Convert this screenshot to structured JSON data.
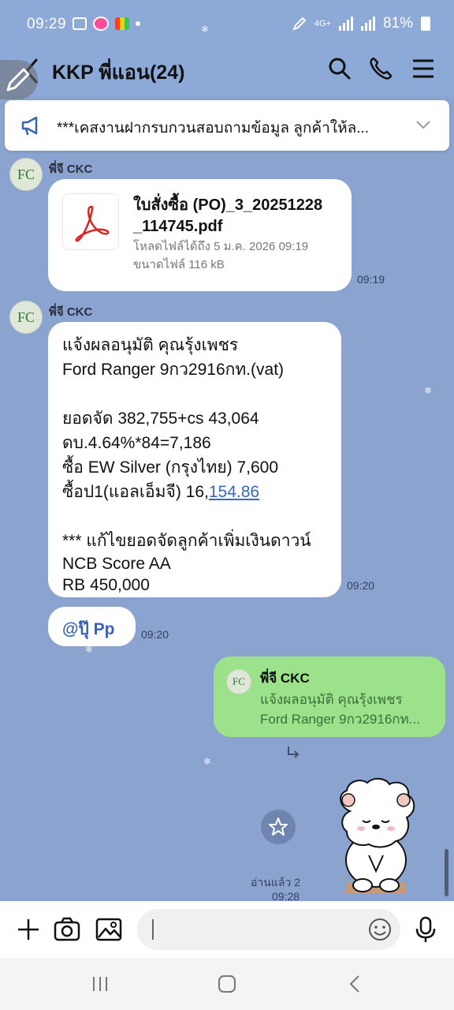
{
  "status_bar": {
    "time": "09:29",
    "network": "4G+",
    "battery": "81%"
  },
  "header": {
    "title": "KKP พี่แอน(24)"
  },
  "announcement": {
    "text": "***เคสงานฝากรบกวนสอบถามข้อมูล ลูกค้าให้ล..."
  },
  "messages": [
    {
      "sender": "พี่จี CKC",
      "avatar_text": "FC",
      "file_name": "ใบสั่งซื้อ (PO)_3_20251228_114745.pdf",
      "file_name_line1": "ใบสั่งซื้อ (PO)_3_20251228",
      "file_name_line2": "_114745.pdf",
      "file_download": "โหลดไฟล์ได้ถึง 5 ม.ค. 2026 09:19",
      "file_size": "ขนาดไฟล์ 116 kB",
      "time": "09:19"
    },
    {
      "sender": "พี่จี CKC",
      "avatar_text": "FC",
      "lines": [
        "แจ้งผลอนุมัติ คุณรุ้งเพชร",
        "Ford Ranger 9กว2916กท.(vat)",
        "",
        "ยอดจัด 382,755+cs 43,064",
        "ดบ.4.64%*84=7,186",
        "ซื้อ EW Silver (กรุงไทย) 7,600"
      ],
      "line_link_prefix": "ซื้อป1(แอลเอ็มจี) 16,",
      "line_link": "154.86",
      "lines_after": [
        "",
        "*** แก้ไขยอดจัดลูกค้าเพิ่มเงินดาวน์",
        "NCB Score AA",
        "RB 450,000"
      ],
      "time": "09:20"
    },
    {
      "mention": "@ปุ๊ Pp",
      "time": "09:20"
    }
  ],
  "my_reply": {
    "quoted_sender": "พี่จี CKC",
    "avatar_text": "FC",
    "quoted_line1": "แจ้งผลอนุมัติ คุณรุ้งเพชร",
    "quoted_line2": "Ford Ranger 9กว2916กท...",
    "read_label": "อ่านแล้ว 2",
    "time": "09:28"
  },
  "input": {
    "placeholder": ""
  },
  "icons": {
    "back": "back-arrow-icon",
    "search": "search-icon",
    "call": "phone-icon",
    "menu": "menu-icon",
    "announce": "megaphone-icon",
    "pdf": "pdf-icon"
  },
  "colors": {
    "chat_background": "#8aa3cf",
    "my_bubble": "#9be28b",
    "link": "#3867c5"
  }
}
